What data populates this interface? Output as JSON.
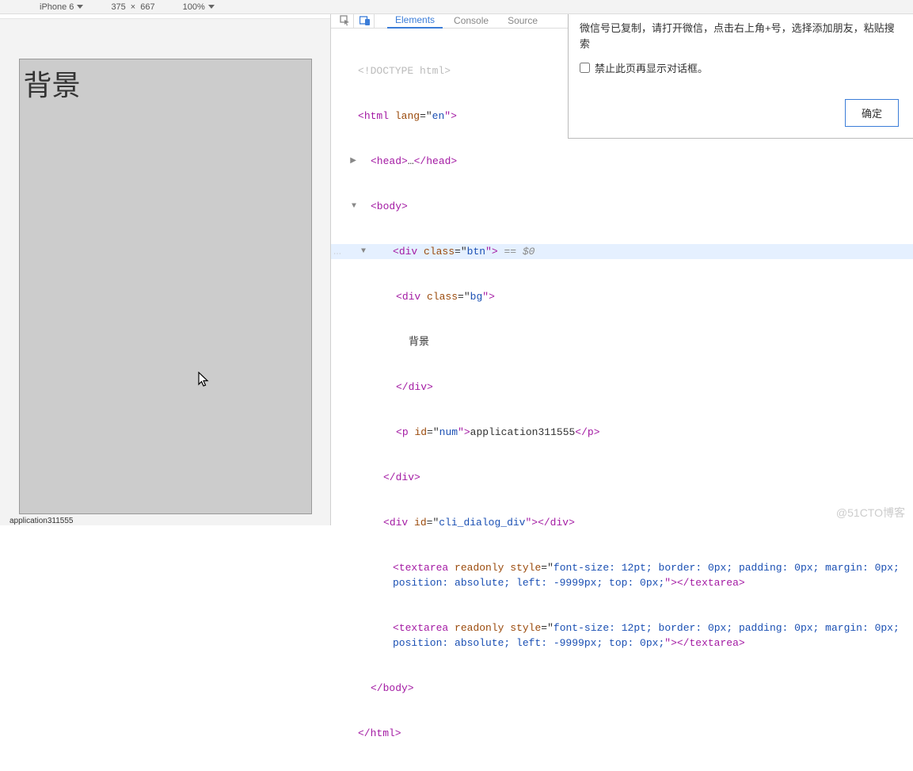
{
  "toolbar": {
    "device": "iPhone 6",
    "width": "375",
    "x": "×",
    "height": "667",
    "zoom": "100%"
  },
  "devtools_tabs": {
    "elements": "Elements",
    "console": "Console",
    "sources": "Source"
  },
  "preview": {
    "bg_text": "背景",
    "app_num": "application311555"
  },
  "dom": {
    "doctype": "<!DOCTYPE html>",
    "html_open_1": "<",
    "html_open_tag": "html",
    "html_open_sp": " ",
    "html_lang_attr": "lang",
    "html_lang_eq": "=\"",
    "html_lang_val": "en",
    "html_lang_close": "\">",
    "head_open": "<head>",
    "head_ellipsis": "…",
    "head_close": "</head>",
    "body_open": "<body>",
    "div_btn_lt": "<",
    "div_btn_tag": "div",
    "div_btn_sp": " ",
    "div_btn_attr": "class",
    "div_btn_eq": "=\"",
    "div_btn_val": "btn",
    "div_btn_gt": "\">",
    "sel_suffix": " == $0",
    "div_bg_lt": "<",
    "div_bg_tag": "div",
    "div_bg_sp": " ",
    "div_bg_attr": "class",
    "div_bg_eq": "=\"",
    "div_bg_val": "bg",
    "div_bg_gt": "\">",
    "bg_text": "背景",
    "div_bg_close": "</div>",
    "p_num_lt": "<",
    "p_num_tag": "p",
    "p_num_sp": " ",
    "p_num_attr": "id",
    "p_num_eq": "=\"",
    "p_num_val": "num",
    "p_num_gt": "\">",
    "p_num_text": "application311555",
    "p_num_close": "</p>",
    "div_btn_close": "</div>",
    "div_cli_lt": "<",
    "div_cli_tag": "div",
    "div_cli_sp": " ",
    "div_cli_attr": "id",
    "div_cli_eq": "=\"",
    "div_cli_val": "cli_dialog_div",
    "div_cli_gt": "\">",
    "div_cli_close": "</div>",
    "ta_lt": "<",
    "ta_tag": "textarea",
    "ta_sp": " ",
    "ta_ro": "readonly",
    "ta_sp2": " ",
    "ta_style_attr": "style",
    "ta_style_eq": "=\"",
    "ta_style_val1": "font-size: 12pt; border: 0px; padding: 0px; margin: 0px;",
    "ta_style_val2": "position: absolute; left: -9999px; top: 0px;",
    "ta_style_close": "\">",
    "ta_close": "</textarea>",
    "body_close": "</body>",
    "html_close": "</html>"
  },
  "dialog": {
    "message": "微信号已复制，请打开微信，点击右上角+号，选择添加朋友，粘贴搜索",
    "checkbox_label": "禁止此页再显示对话框。",
    "ok_label": "确定"
  },
  "watermark": "@51CTO博客"
}
